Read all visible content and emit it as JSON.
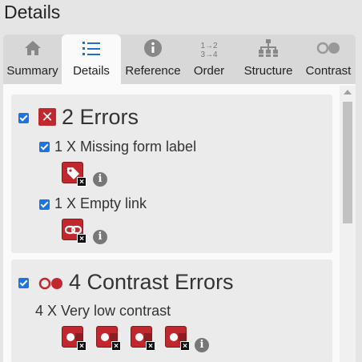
{
  "header": {
    "title": "Details"
  },
  "tabs": [
    {
      "label": "Summary",
      "icon": "home-icon"
    },
    {
      "label": "Details",
      "icon": "list-icon",
      "active": true
    },
    {
      "label": "Reference",
      "icon": "info-icon"
    },
    {
      "label": "Order",
      "icon": "order-icon",
      "glyph_top": "1→2",
      "glyph_bottom": "3→4"
    },
    {
      "label": "Structure",
      "icon": "hierarchy-icon"
    },
    {
      "label": "Contrast",
      "icon": "contrast-icon"
    }
  ],
  "errors_section": {
    "heading": "2 Errors",
    "icon_glyph": "✕",
    "items": [
      {
        "label": "1 X Missing form label",
        "icon": "missing-label-icon",
        "checked": true
      },
      {
        "label": "1 X Empty link",
        "icon": "empty-link-icon",
        "checked": true
      }
    ],
    "checked": true
  },
  "contrast_section": {
    "heading": "4 Contrast Errors",
    "checked": true,
    "items": [
      {
        "label": "4 X Very low contrast",
        "count": 4
      }
    ]
  },
  "badge_close_glyph": "×",
  "info_glyph": "i",
  "colors": {
    "error_red": "#c0282d",
    "checkbox_blue": "#1a73e8",
    "panel_bg": "#fafafa",
    "card_bg": "#ebebeb"
  }
}
